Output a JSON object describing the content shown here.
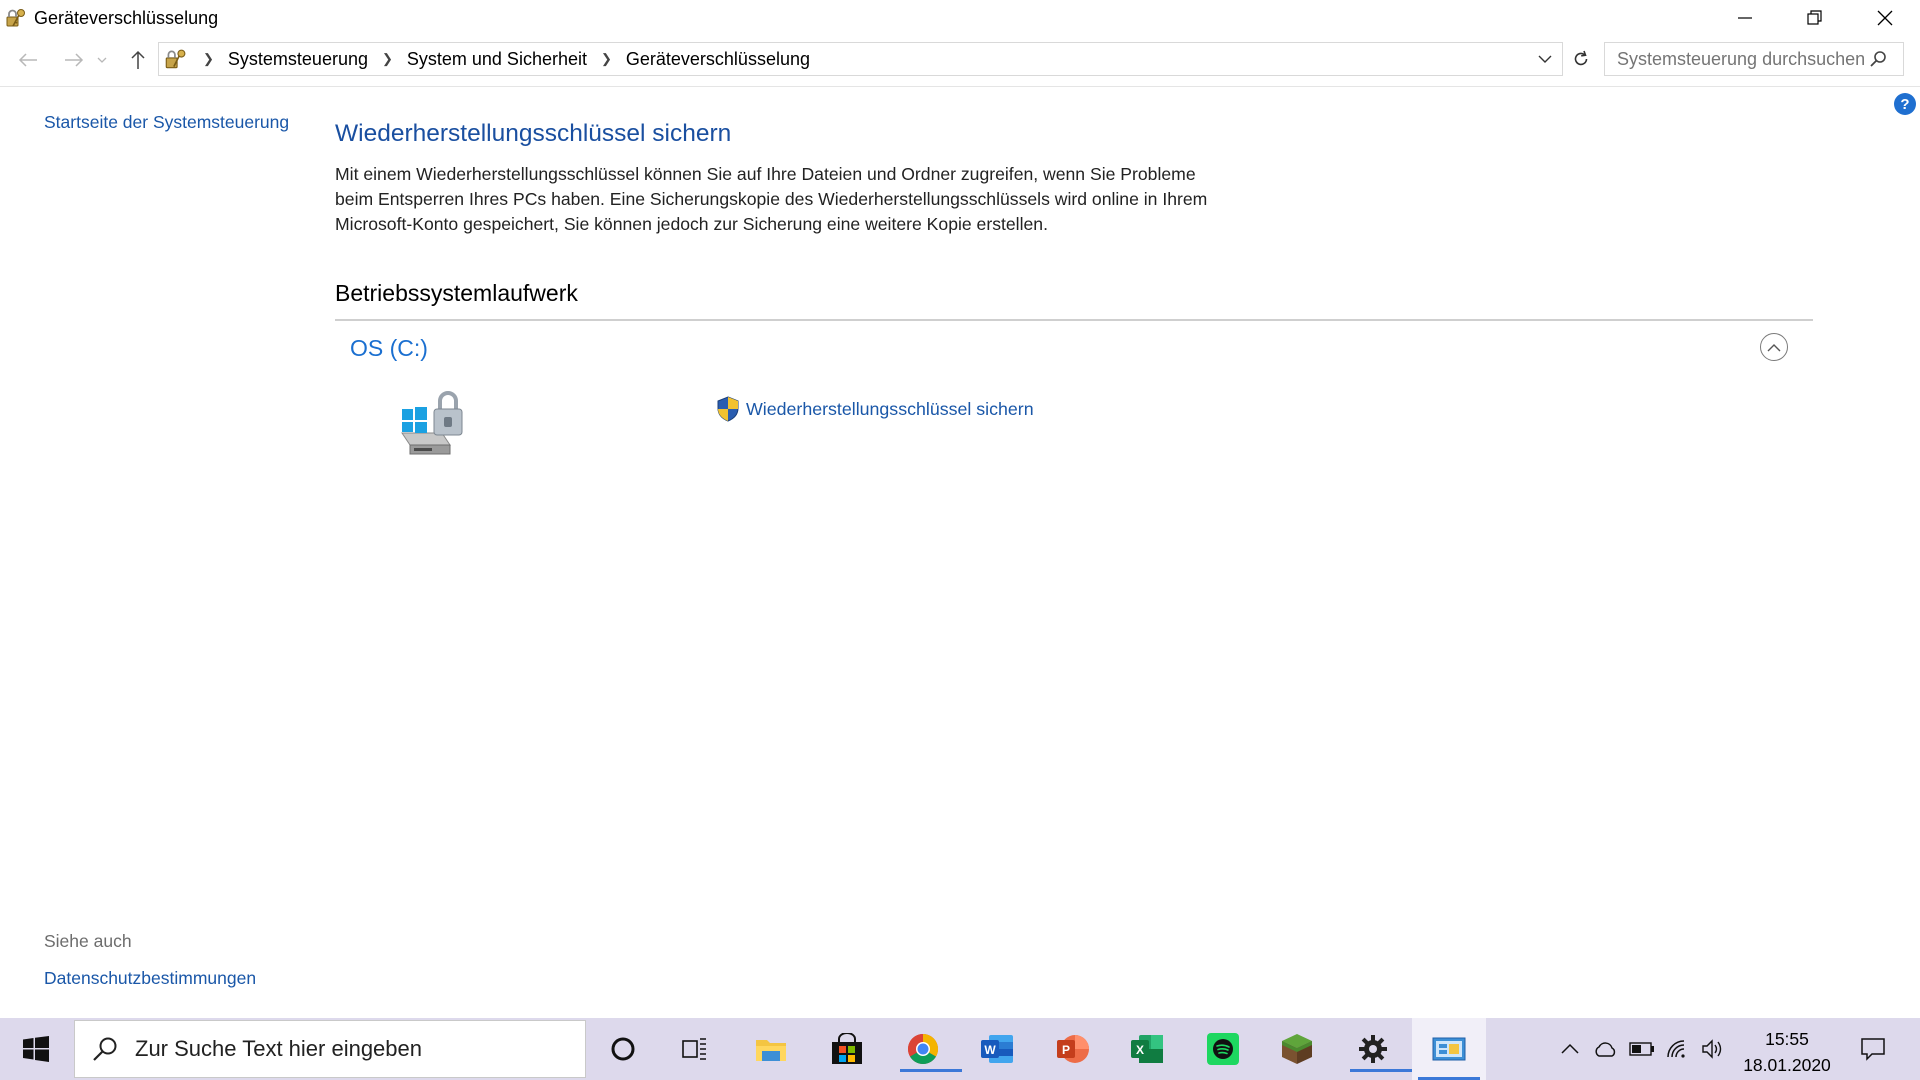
{
  "window": {
    "title": "Geräteverschlüsselung",
    "icon": "key-lock-icon"
  },
  "addressbar": {
    "icon": "control-panel-icon",
    "breadcrumbs": [
      "Systemsteuerung",
      "System und Sicherheit",
      "Geräteverschlüsselung"
    ],
    "search_placeholder": "Systemsteuerung durchsuchen"
  },
  "left_pane": {
    "home_link": "Startseite der Systemsteuerung",
    "see_also_heading": "Siehe auch",
    "see_also_links": [
      "Datenschutzbestimmungen"
    ]
  },
  "main": {
    "heading": "Wiederherstellungsschlüssel sichern",
    "description_lines": [
      "Mit einem Wiederherstellungsschlüssel können Sie auf Ihre Dateien und Ordner zugreifen, wenn Sie Probleme",
      "beim Entsperren Ihres PCs haben. Eine Sicherungskopie des Wiederherstellungsschlüssels wird online in Ihrem",
      "Microsoft-Konto gespeichert, Sie können jedoch zur Sicherung eine weitere Kopie erstellen."
    ],
    "section_title": "Betriebssystemlaufwerk",
    "drive": {
      "name": "OS (C:)",
      "action_label": "Wiederherstellungsschlüssel sichern"
    }
  },
  "taskbar": {
    "search_placeholder": "Zur Suche Text hier eingeben",
    "apps": [
      "cortana-icon",
      "task-view-icon",
      "file-explorer-icon",
      "store-icon",
      "chrome-icon",
      "word-icon",
      "powerpoint-icon",
      "excel-icon",
      "spotify-icon",
      "minecraft-icon",
      "settings-icon",
      "control-panel-icon"
    ],
    "clock": {
      "time": "15:55",
      "date": "18.01.2020"
    }
  },
  "colors": {
    "link": "#1a57a8",
    "heading": "#1a4fa0",
    "taskbar": "#ddd9ec",
    "accent": "#3b78d8"
  }
}
